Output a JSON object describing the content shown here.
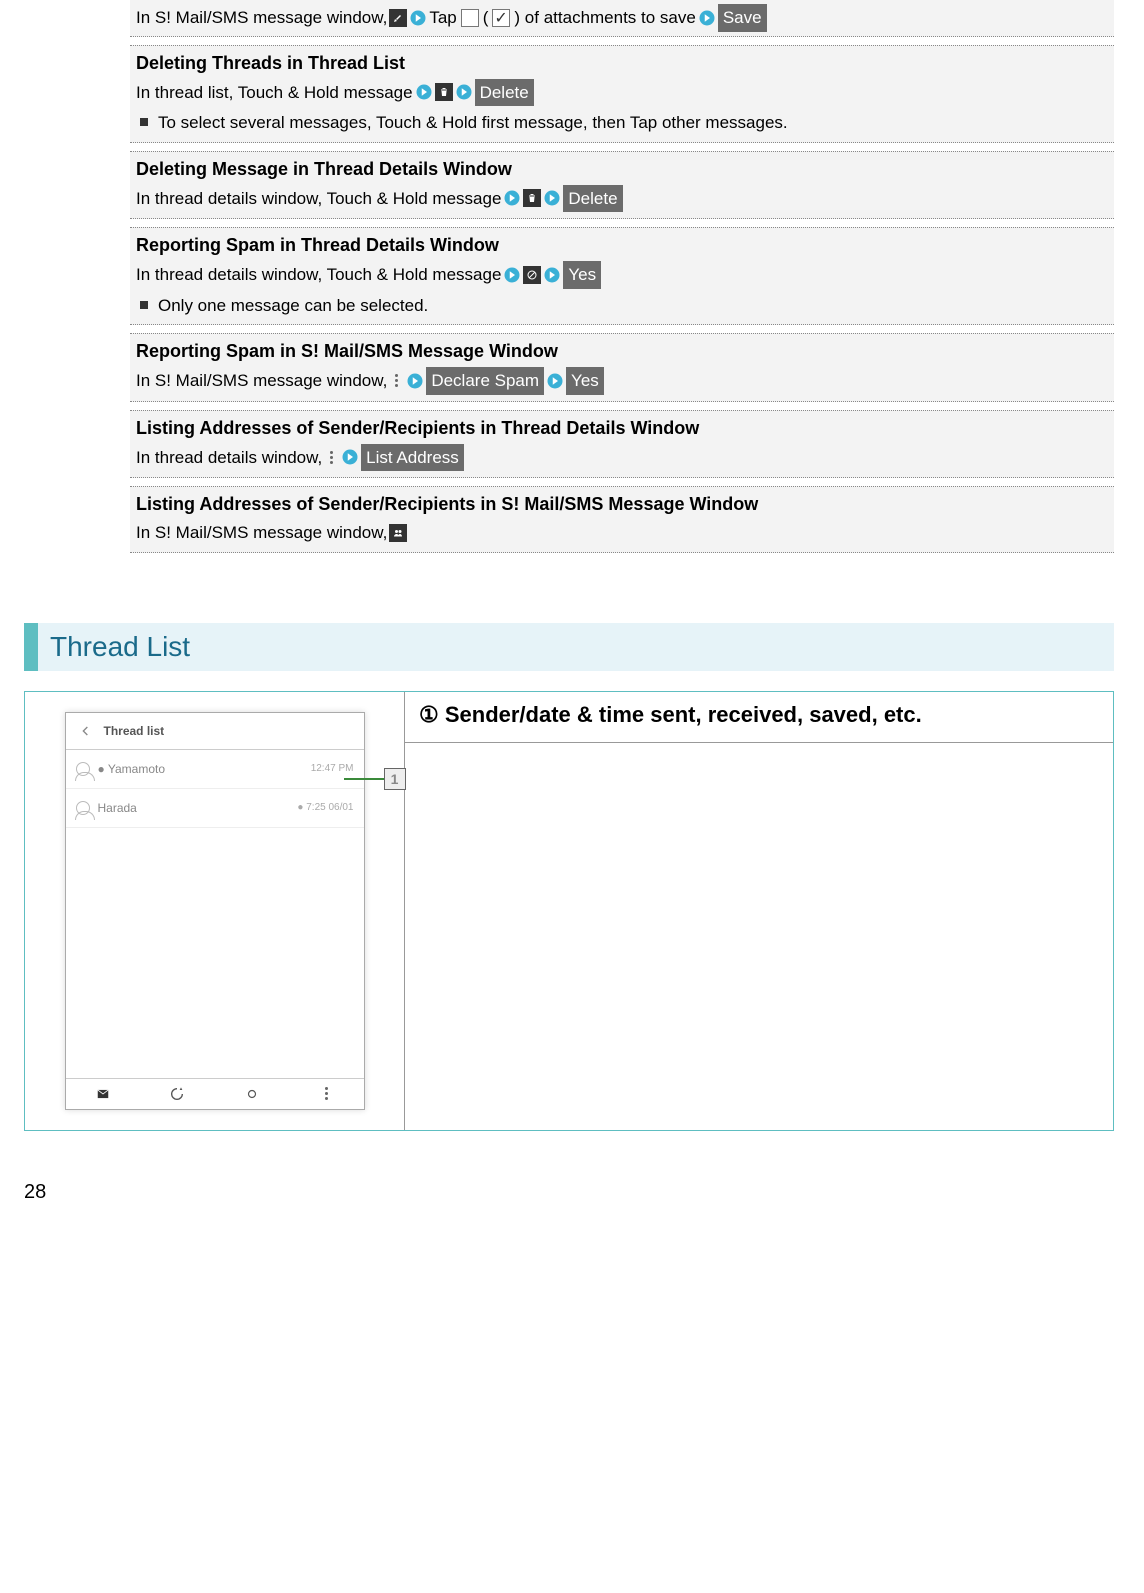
{
  "section0": {
    "text_a": "In S! Mail/SMS message window, ",
    "text_b": " Tap ",
    "text_c": " (",
    "text_d": ") of attachments to save",
    "btn": "Save"
  },
  "section1": {
    "title": "Deleting Threads in Thread List",
    "text": "In thread list, Touch & Hold message",
    "btn": "Delete",
    "note": "To select several messages, Touch & Hold first message, then Tap other messages."
  },
  "section2": {
    "title": "Deleting Message in Thread Details Window",
    "text": "In thread details window, Touch & Hold message",
    "btn": "Delete"
  },
  "section3": {
    "title": "Reporting Spam in Thread Details Window",
    "text": "In thread details window, Touch & Hold message",
    "btn": "Yes",
    "note": "Only one message can be selected."
  },
  "section4": {
    "title": "Reporting Spam in S! Mail/SMS Message Window",
    "text": "In S! Mail/SMS message window, ",
    "btn1": "Declare Spam",
    "btn2": "Yes"
  },
  "section5": {
    "title": "Listing Addresses of Sender/Recipients in Thread Details Window",
    "text": "In thread details window, ",
    "btn": "List Address"
  },
  "section6": {
    "title": "Listing Addresses of Sender/Recipients in S! Mail/SMS Message Window",
    "text": "In S! Mail/SMS message window, "
  },
  "heading": "Thread List",
  "callout": {
    "num": "①",
    "text": " Sender/date & time sent, received, saved, etc."
  },
  "phone": {
    "header": "Thread list",
    "row1_name": "● Yamamoto",
    "row1_time": "12:47 PM",
    "row2_name": "Harada",
    "row2_time": "● 7:25 06/01",
    "callout_label": "1"
  },
  "page": "28"
}
